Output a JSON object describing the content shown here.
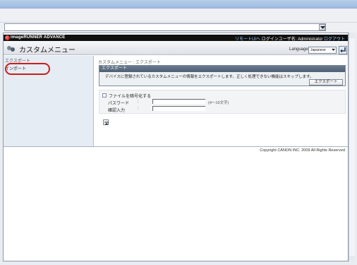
{
  "header": {
    "brand": "imageRUNNER ADVANCE",
    "remote_ui_link": "リモートUIへ",
    "login_user_label": "ログインユーザ名:",
    "login_user": "Administrator",
    "logout_link": "ログアウト"
  },
  "page": {
    "title": "カスタムメニュー",
    "language_label": "Language",
    "language_value": "Japanese"
  },
  "sidebar": {
    "items": [
      {
        "label": "エクスポート"
      },
      {
        "label": "インポート"
      }
    ]
  },
  "main": {
    "breadcrumb": "カスタムメニュー : エクスポート",
    "section_title": "エクスポート",
    "description": "デバイスに登録されているカスタムメニューの情報をエクスポートします。正しく処理できない機能はスキップします。",
    "export_button": "エクスポート",
    "encrypt_label": "ファイルを暗号化する",
    "password_label": "パスワード",
    "password_hint": "(4～16文字)",
    "confirm_label": "確認入力"
  },
  "footer": {
    "copyright": "Copyright CANON INC. 2009 All Rights Reserved"
  }
}
